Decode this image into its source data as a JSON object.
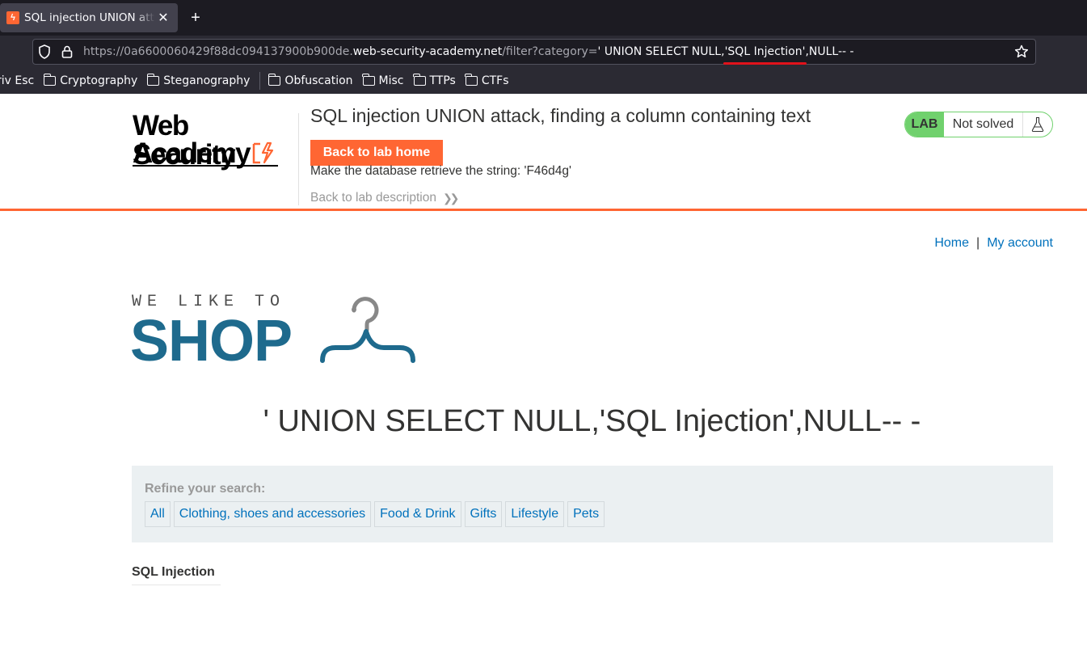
{
  "browser": {
    "tab_title": "SQL injection UNION attac",
    "tab_close": "✕",
    "new_tab": "+",
    "url": {
      "scheme_prefix": "https://0a6600060429f88dc094137900b900de.",
      "host": "web-security-academy.net",
      "path": "/filter?category=",
      "query_part1": "' UNION SELECT NULL,",
      "query_highlight": "'SQL Injection'",
      "query_part2": ",NULL-- -"
    },
    "bookmarks": [
      {
        "label": "riv Esc",
        "folder": false
      },
      {
        "label": "Cryptography",
        "folder": true
      },
      {
        "label": "Steganography",
        "folder": true
      },
      {
        "label": "Obfuscation",
        "folder": true
      },
      {
        "label": "Misc",
        "folder": true
      },
      {
        "label": "TTPs",
        "folder": true
      },
      {
        "label": "CTFs",
        "folder": true
      }
    ]
  },
  "lab": {
    "logo_line1": "Web Security",
    "logo_line2": "Academy",
    "title": "SQL injection UNION attack, finding a column containing text",
    "back_home": "Back to lab home",
    "description": "Make the database retrieve the string: 'F46d4g'",
    "back_description": "Back to lab description",
    "badge_label": "LAB",
    "status": "Not solved",
    "colors": {
      "accent": "#ff6633",
      "badge": "#70d16d",
      "link": "#0071bc",
      "shop": "#1e6a8d"
    }
  },
  "nav": {
    "home": "Home",
    "separator": "|",
    "account": "My account"
  },
  "shop": {
    "tagline": "WE LIKE TO",
    "name": "SHOP"
  },
  "search_heading": "' UNION SELECT NULL,'SQL Injection',NULL-- -",
  "filter": {
    "label": "Refine your search:",
    "categories": [
      "All",
      "Clothing, shoes and accessories",
      "Food & Drink",
      "Gifts",
      "Lifestyle",
      "Pets"
    ]
  },
  "results": [
    {
      "title": "SQL Injection"
    }
  ]
}
